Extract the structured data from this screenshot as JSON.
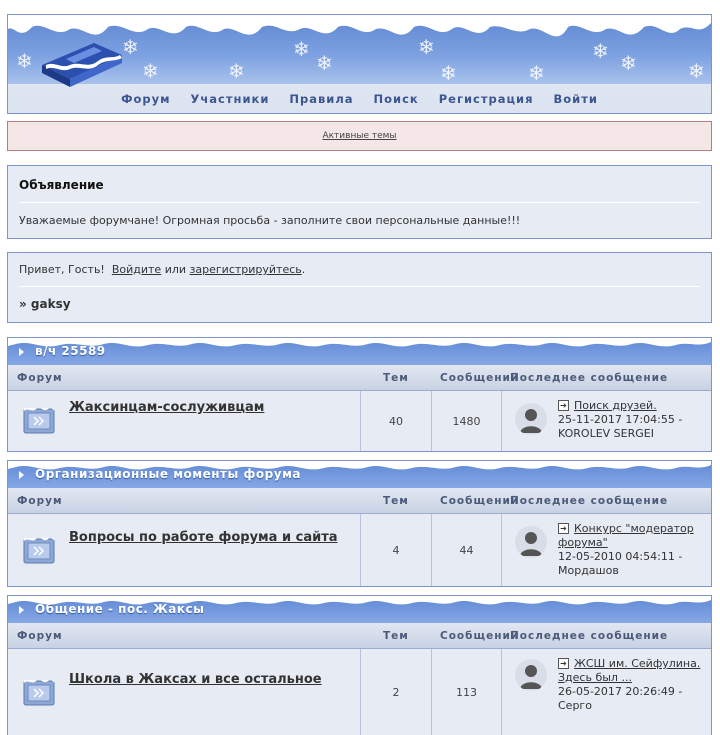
{
  "nav": {
    "items": [
      "Форум",
      "Участники",
      "Правила",
      "Поиск",
      "Регистрация",
      "Войти"
    ]
  },
  "active_topics": "Активные темы",
  "announcement": {
    "title": "Объявление",
    "text": "Уважаемые форумчане! Огромная просьба - заполните свои персональные данные!!!"
  },
  "welcome": {
    "greeting": "Привет, Гость!",
    "login_link": "Войдите",
    "or": "или",
    "register_link": "зарегистрируйтесь",
    "period": ".",
    "user_line": "» gaksy"
  },
  "columns": {
    "forum": "Форум",
    "topics": "Тем",
    "posts": "Сообщений",
    "last_post": "Последнее сообщение"
  },
  "categories": [
    {
      "title": "в/ч 25589",
      "forums": [
        {
          "name": "Жаксинцам-сослуживцам",
          "topics": "40",
          "posts": "1480",
          "last_topic": "Поиск друзей.",
          "last_date": "25-11-2017 17:04:55 -",
          "last_author": "KOROLEV SERGEI"
        }
      ]
    },
    {
      "title": "Организационные моменты форума",
      "forums": [
        {
          "name": "Вопросы по работе форума и сайта",
          "topics": "4",
          "posts": "44",
          "last_topic": "Конкурс \"модератор форума\"",
          "last_date": "12-05-2010 04:54:11 -",
          "last_author": "Мордашов"
        }
      ]
    },
    {
      "title": "Общение - пос. Жаксы",
      "forums": [
        {
          "name": "Школа в Жаксах и все остальное",
          "topics": "2",
          "posts": "113",
          "last_topic": "ЖСШ им. Сейфулина. Здесь был ...",
          "last_date": "26-05-2017 20:26:49 -",
          "last_author": "Серго"
        }
      ]
    }
  ],
  "colors": {
    "banner": "#6a90d8",
    "border": "#7d95c8",
    "panel": "#e6ebf4",
    "nav_text": "#3d5590",
    "active_border": "#b87b82"
  }
}
